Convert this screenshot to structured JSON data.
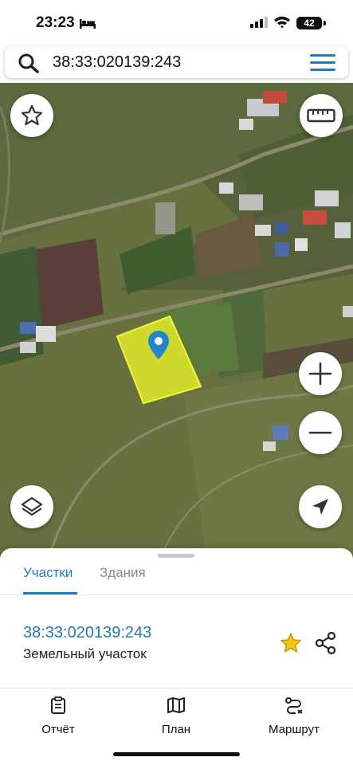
{
  "status_bar": {
    "time": "23:23",
    "battery": "42",
    "icons": [
      "bed-icon",
      "signal-icon",
      "wifi-icon",
      "battery-icon"
    ]
  },
  "search": {
    "query": "38:33:020139:243",
    "icons": [
      "search-icon",
      "menu-icon"
    ]
  },
  "map": {
    "layer": "satellite",
    "parcel_highlight_color": "#e8ee2a",
    "marker_color": "#1f86c8",
    "controls": [
      "favorites-star-icon",
      "ruler-icon",
      "zoom-in-icon",
      "zoom-out-icon",
      "layers-icon",
      "locate-arrow-icon"
    ]
  },
  "sheet": {
    "tabs": [
      {
        "label": "Участки",
        "active": true
      },
      {
        "label": "Здания",
        "active": false
      }
    ],
    "result": {
      "cadastral_number": "38:33:020139:243",
      "type": "Земельный участок"
    },
    "accent_color": "#1f7ab6",
    "star_color": "#f2c511"
  },
  "bottom_nav": {
    "items": [
      {
        "label": "Отчёт",
        "icon": "report-icon"
      },
      {
        "label": "План",
        "icon": "map-plan-icon"
      },
      {
        "label": "Маршрут",
        "icon": "route-icon"
      }
    ]
  }
}
